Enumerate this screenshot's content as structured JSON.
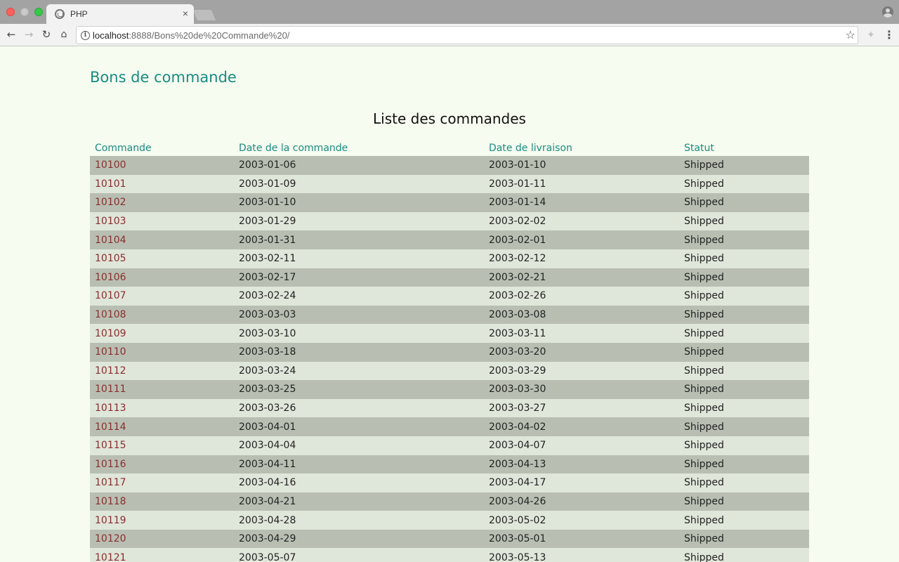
{
  "browser": {
    "tab_title": "PHP",
    "tab_close": "×",
    "url_host": "localhost",
    "url_rest": ":8888/Bons%20de%20Commande%20/"
  },
  "page": {
    "title": "Bons de commande",
    "table_caption": "Liste des commandes"
  },
  "table": {
    "headers": [
      "Commande",
      "Date de la commande",
      "Date de livraison",
      "Statut"
    ],
    "rows": [
      [
        "10100",
        "2003-01-06",
        "2003-01-10",
        "Shipped"
      ],
      [
        "10101",
        "2003-01-09",
        "2003-01-11",
        "Shipped"
      ],
      [
        "10102",
        "2003-01-10",
        "2003-01-14",
        "Shipped"
      ],
      [
        "10103",
        "2003-01-29",
        "2003-02-02",
        "Shipped"
      ],
      [
        "10104",
        "2003-01-31",
        "2003-02-01",
        "Shipped"
      ],
      [
        "10105",
        "2003-02-11",
        "2003-02-12",
        "Shipped"
      ],
      [
        "10106",
        "2003-02-17",
        "2003-02-21",
        "Shipped"
      ],
      [
        "10107",
        "2003-02-24",
        "2003-02-26",
        "Shipped"
      ],
      [
        "10108",
        "2003-03-03",
        "2003-03-08",
        "Shipped"
      ],
      [
        "10109",
        "2003-03-10",
        "2003-03-11",
        "Shipped"
      ],
      [
        "10110",
        "2003-03-18",
        "2003-03-20",
        "Shipped"
      ],
      [
        "10112",
        "2003-03-24",
        "2003-03-29",
        "Shipped"
      ],
      [
        "10111",
        "2003-03-25",
        "2003-03-30",
        "Shipped"
      ],
      [
        "10113",
        "2003-03-26",
        "2003-03-27",
        "Shipped"
      ],
      [
        "10114",
        "2003-04-01",
        "2003-04-02",
        "Shipped"
      ],
      [
        "10115",
        "2003-04-04",
        "2003-04-07",
        "Shipped"
      ],
      [
        "10116",
        "2003-04-11",
        "2003-04-13",
        "Shipped"
      ],
      [
        "10117",
        "2003-04-16",
        "2003-04-17",
        "Shipped"
      ],
      [
        "10118",
        "2003-04-21",
        "2003-04-26",
        "Shipped"
      ],
      [
        "10119",
        "2003-04-28",
        "2003-05-02",
        "Shipped"
      ],
      [
        "10120",
        "2003-04-29",
        "2003-05-01",
        "Shipped"
      ],
      [
        "10121",
        "2003-05-07",
        "2003-05-13",
        "Shipped"
      ]
    ]
  },
  "colors": {
    "accent": "#1a8c80",
    "order_link": "#8a2d2d",
    "row_dark": "#b8bfb2",
    "row_light": "#dfe6da",
    "page_bg": "#f6fcf0"
  }
}
